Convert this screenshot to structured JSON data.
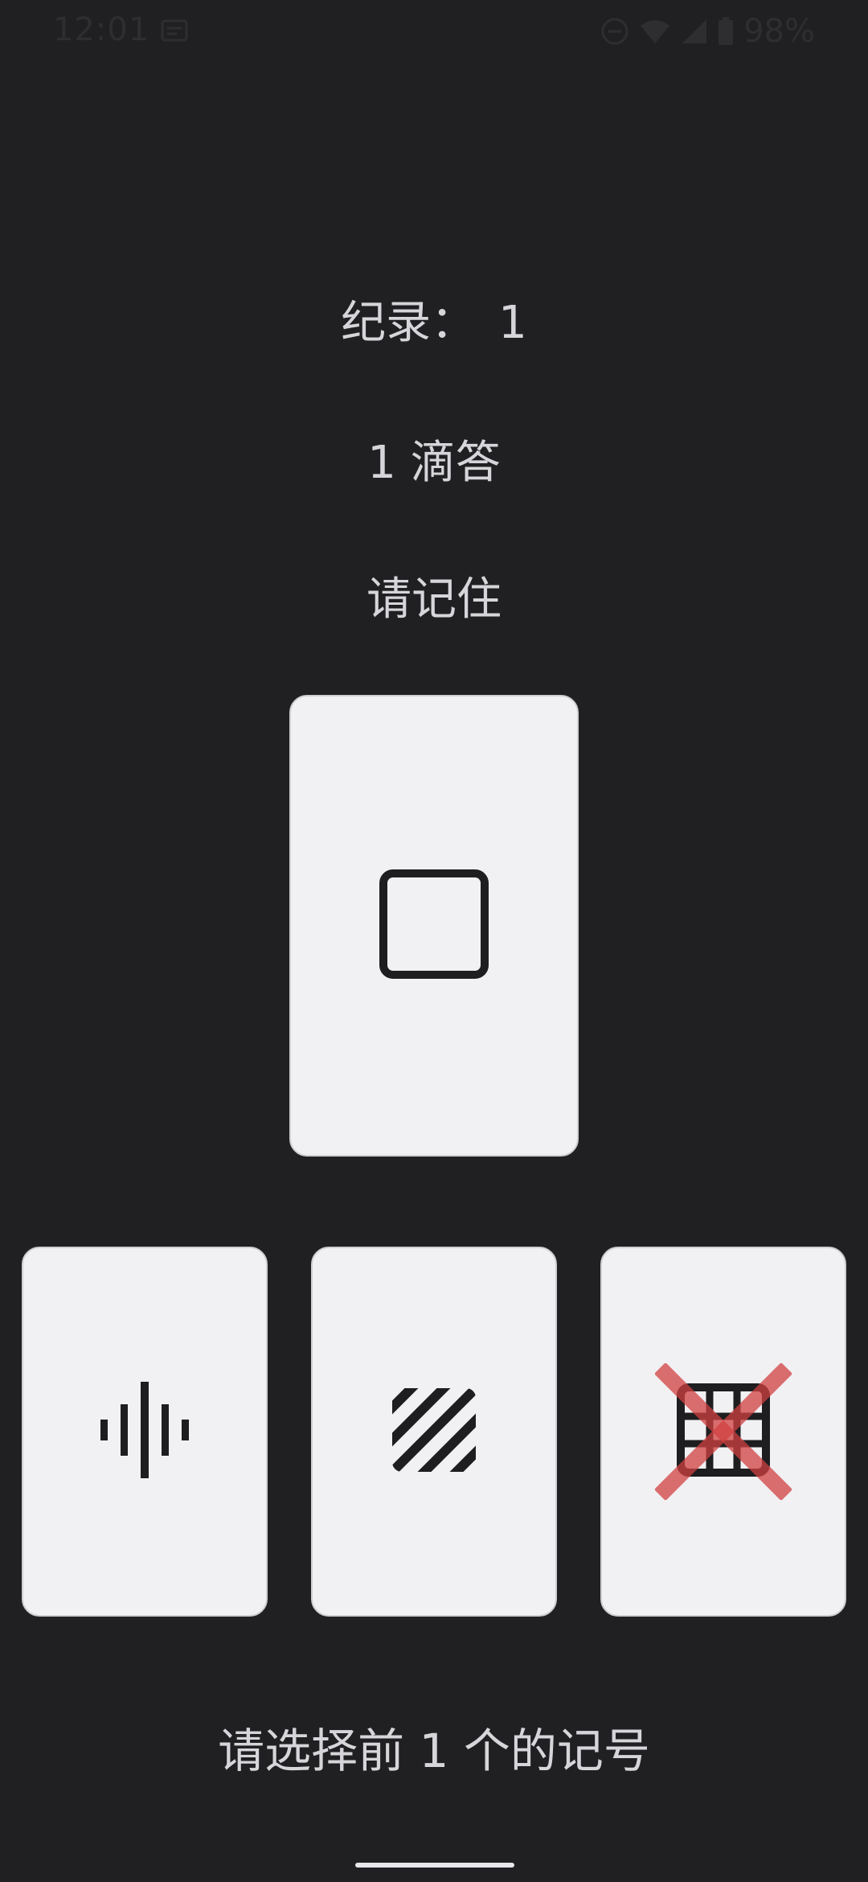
{
  "status_bar": {
    "time": "12:01",
    "battery": "98%",
    "icons": [
      "message-icon",
      "do-not-disturb-icon",
      "wifi-icon",
      "signal-icon",
      "battery-icon"
    ]
  },
  "game": {
    "record_label": "纪录：",
    "record_value": "1",
    "ticks_text": "1 滴答",
    "remember_text": "请记住",
    "prompt_text": "请选择前 1 个的记号",
    "shown_card": {
      "symbol": "square-icon"
    },
    "options": [
      {
        "symbol": "waveform-icon",
        "crossed": false
      },
      {
        "symbol": "diagonal-stripes-icon",
        "crossed": false
      },
      {
        "symbol": "grid-icon",
        "crossed": true
      }
    ]
  },
  "colors": {
    "background": "#202022",
    "card": "#f1f0f3",
    "text": "#d6d6da",
    "symbol": "#1e1e20",
    "cross": "#d04040"
  }
}
